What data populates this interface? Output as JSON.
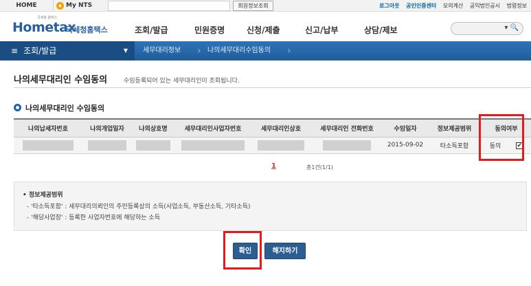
{
  "topbar": {
    "home": "HOME",
    "my_nts": "My NTS",
    "member_lookup_button": "회원정보조회",
    "links": [
      "로그아웃",
      "공인인증센터",
      "모의계산",
      "공익법인공시",
      "법령정보"
    ]
  },
  "header": {
    "logo_small": "국세청 홈택스",
    "logo_main": "Hometax",
    "logo_sub": "국세청홈택스",
    "nav": [
      "조회/발급",
      "민원증명",
      "신청/제출",
      "신고/납부",
      "상담/제보"
    ]
  },
  "breadcrumb": {
    "menu_label": "조회/발급",
    "items": [
      "세무대리정보",
      "나의세무대리수임동의"
    ]
  },
  "page": {
    "title": "나의세무대리인 수임동의",
    "subtitle": "수임등록되어 있는 세무대리인이 조회됩니다."
  },
  "section": {
    "title": "나의세무대리인 수임동의"
  },
  "table": {
    "headers": [
      "나의납세자번호",
      "나의개업일자",
      "나의상호명",
      "세무대리인사업자번호",
      "세무대리인상호",
      "세무대리인 전화번호",
      "수임일자",
      "정보제공범위",
      "동의여부"
    ],
    "row": {
      "date": "2015-09-02",
      "scope": "타소득포함",
      "consent": "동의",
      "checked": "✔"
    }
  },
  "pagination": {
    "current": "1",
    "total": "총1건(1/1)"
  },
  "info": {
    "title": "정보제공범위",
    "lines": [
      "- '타소득포함' : 세무대리의뢰인의 주민등록상의 소득(사업소득, 부동산소득, 기타소득)",
      "- '해당사업장' : 등록한 사업자번호에 해당하는 소득"
    ]
  },
  "buttons": {
    "confirm": "확인",
    "cancel": "해지하기"
  },
  "colors": {
    "brand_blue": "#1e5fa8",
    "highlight_red": "#e31b1b"
  }
}
